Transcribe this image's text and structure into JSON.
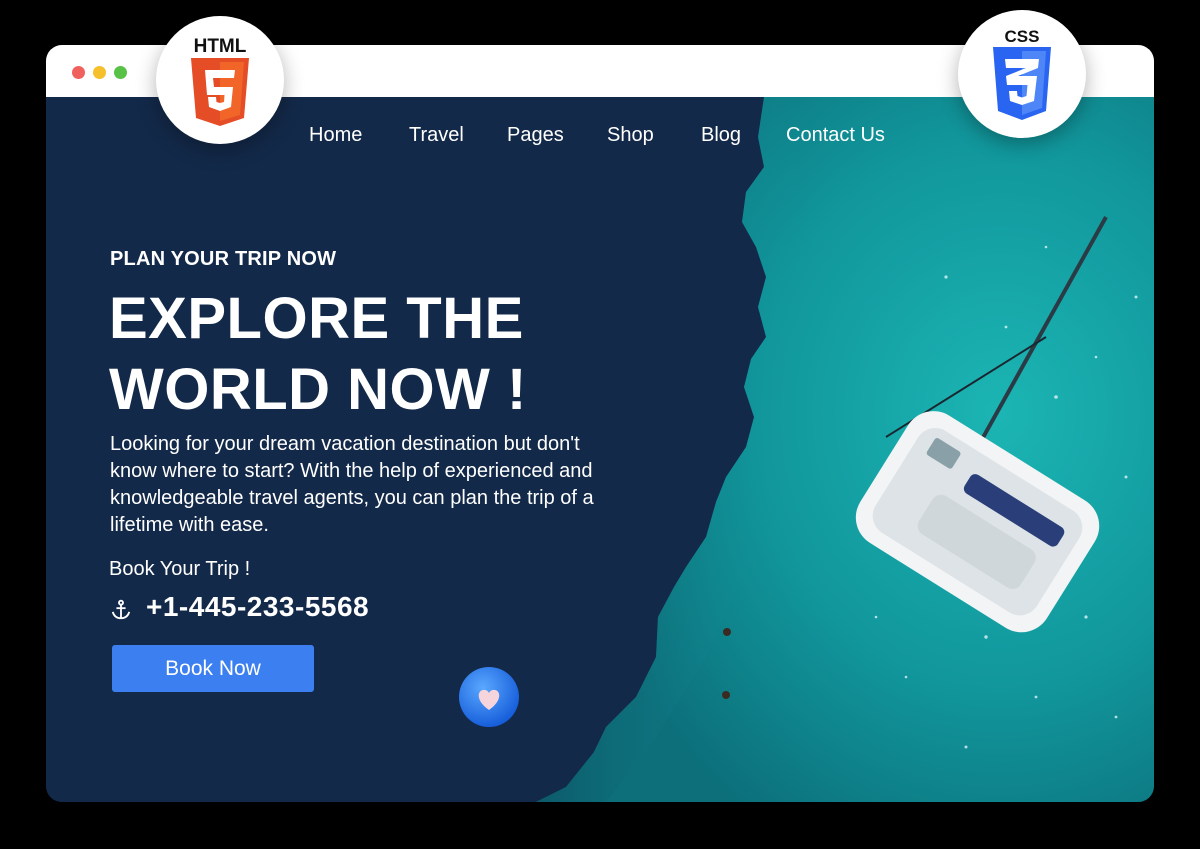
{
  "window": {
    "controls": [
      "close",
      "minimize",
      "maximize"
    ]
  },
  "badges": {
    "html_label": "HTML",
    "html_icon": "html5-shield-icon",
    "html_color": "#e44d26",
    "css_label": "CSS",
    "css_icon": "css3-shield-icon",
    "css_color": "#2965f1"
  },
  "nav": {
    "items": [
      {
        "label": "Home"
      },
      {
        "label": "Travel"
      },
      {
        "label": "Pages"
      },
      {
        "label": "Shop"
      },
      {
        "label": "Blog"
      },
      {
        "label": "Contact Us"
      }
    ]
  },
  "hero": {
    "eyebrow": "PLAN YOUR TRIP NOW",
    "headline_line1": "EXPLORE THE",
    "headline_line2": "WORLD NOW !",
    "description": "Looking for your dream vacation destination but don't know where to start? With the help of experienced and knowledgeable travel agents, you can plan the trip of a lifetime with ease.",
    "book_label": "Book Your Trip !",
    "phone_icon": "anchor-icon",
    "phone": "+1-445-233-5568",
    "cta_label": "Book Now",
    "image_subject": "aerial view of catamaran on turquoise sea",
    "favorite_icon": "heart-icon"
  },
  "colors": {
    "page_bg": "#000000",
    "hero_bg": "#132949",
    "sea": "#13a2a6",
    "button": "#3c7ff0",
    "titlebar": "#ffffff"
  }
}
